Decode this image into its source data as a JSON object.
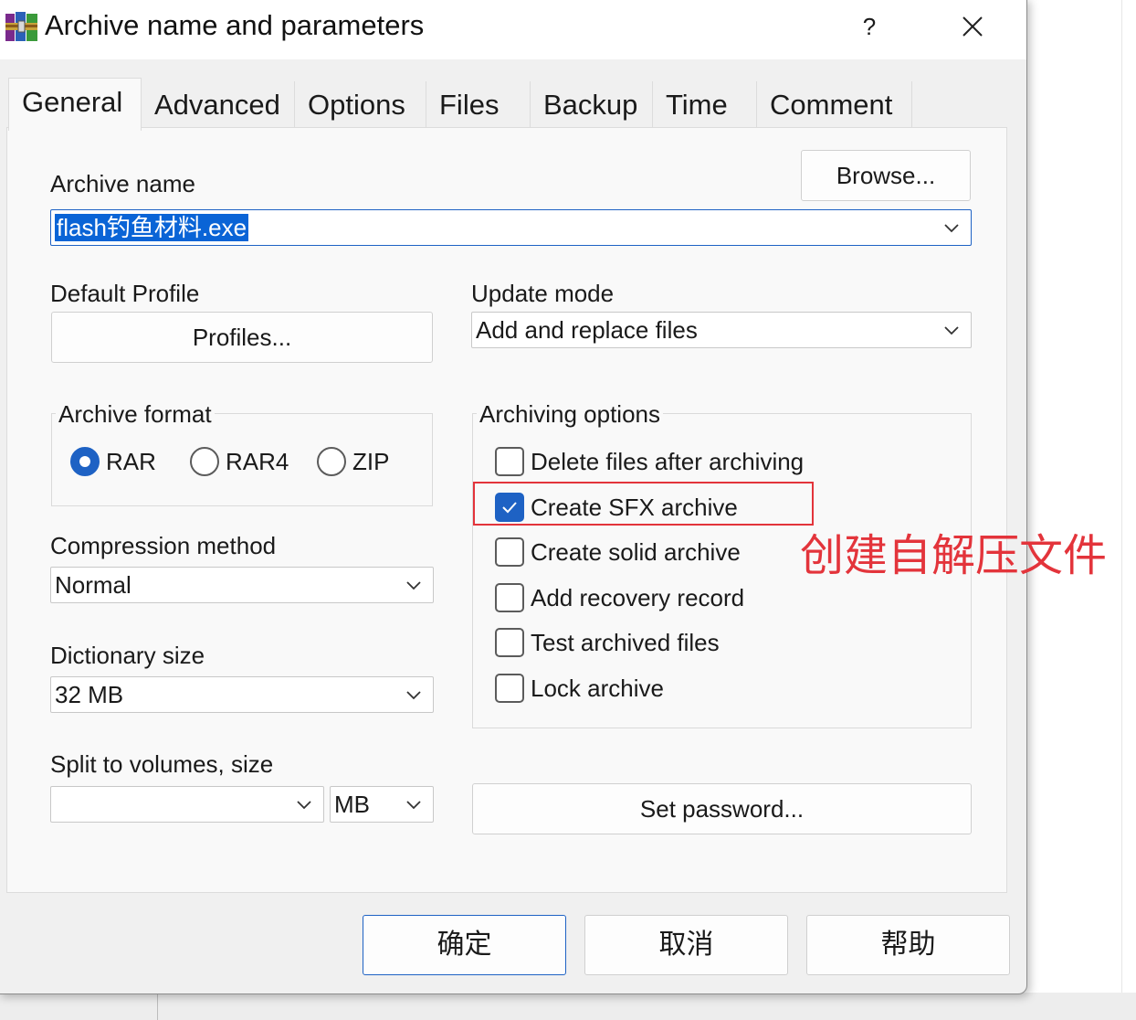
{
  "window": {
    "title": "Archive name and parameters",
    "help_label": "?",
    "close_label": "✕",
    "icon": "winrar-books-icon"
  },
  "tabs": [
    {
      "label": "General",
      "active": true
    },
    {
      "label": "Advanced"
    },
    {
      "label": "Options"
    },
    {
      "label": "Files"
    },
    {
      "label": "Backup"
    },
    {
      "label": "Time"
    },
    {
      "label": "Comment"
    }
  ],
  "archive_name": {
    "label": "Archive name",
    "value": "flash钓鱼材料.exe",
    "browse_label": "Browse..."
  },
  "default_profile": {
    "label": "Default Profile",
    "button_label": "Profiles..."
  },
  "update_mode": {
    "label": "Update mode",
    "value": "Add and replace files"
  },
  "archive_format": {
    "label": "Archive format",
    "options": [
      {
        "label": "RAR",
        "selected": true
      },
      {
        "label": "RAR4",
        "selected": false
      },
      {
        "label": "ZIP",
        "selected": false
      }
    ]
  },
  "archiving_options": {
    "label": "Archiving options",
    "items": [
      {
        "label": "Delete files after archiving",
        "checked": false
      },
      {
        "label": "Create SFX archive",
        "checked": true
      },
      {
        "label": "Create solid archive",
        "checked": false
      },
      {
        "label": "Add recovery record",
        "checked": false
      },
      {
        "label": "Test archived files",
        "checked": false
      },
      {
        "label": "Lock archive",
        "checked": false
      }
    ]
  },
  "compression_method": {
    "label": "Compression method",
    "value": "Normal"
  },
  "dictionary_size": {
    "label": "Dictionary size",
    "value": "32 MB"
  },
  "split_volumes": {
    "label": "Split to volumes, size",
    "value": "",
    "unit": "MB"
  },
  "set_password_label": "Set password...",
  "footer": {
    "ok_label": "确定",
    "cancel_label": "取消",
    "help_label": "帮助"
  },
  "annotation": {
    "text": "创建自解压文件",
    "color": "#e3343b"
  },
  "colors": {
    "accent": "#1e62c4",
    "selection": "#0a64d6",
    "annotation": "#e3343b"
  }
}
